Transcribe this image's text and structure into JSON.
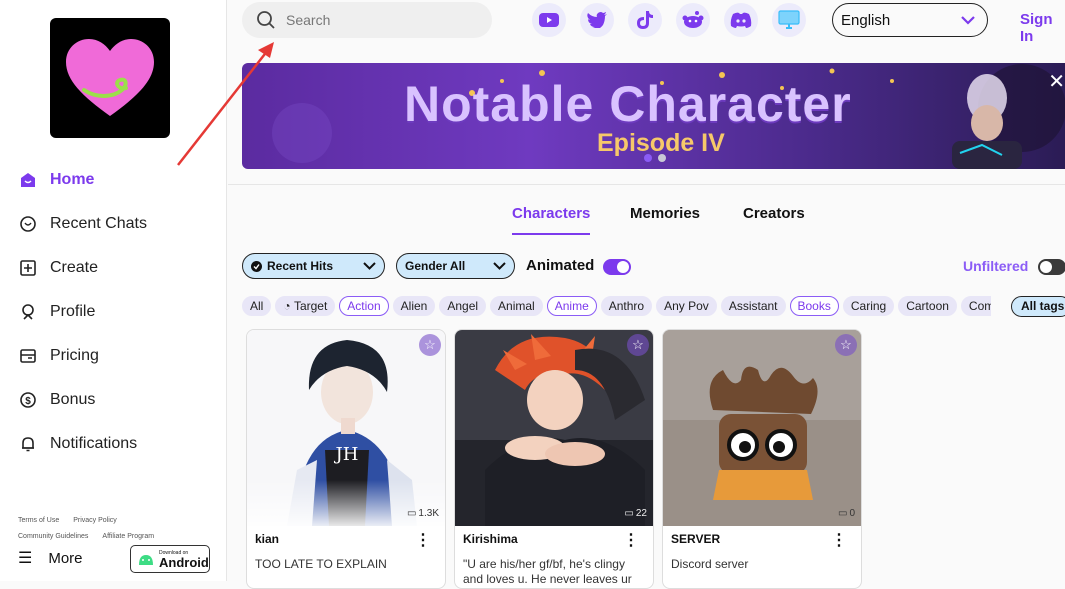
{
  "sidebar": {
    "items": [
      {
        "label": "Home",
        "icon": "home-icon",
        "active": true
      },
      {
        "label": "Recent Chats",
        "icon": "chat-icon"
      },
      {
        "label": "Create",
        "icon": "plus-square-icon"
      },
      {
        "label": "Profile",
        "icon": "profile-icon"
      },
      {
        "label": "Pricing",
        "icon": "card-icon"
      },
      {
        "label": "Bonus",
        "icon": "dollar-icon"
      },
      {
        "label": "Notifications",
        "icon": "bell-icon"
      }
    ],
    "footer_links_row1": [
      "Terms of Use",
      "Privacy Policy"
    ],
    "footer_links_row2": [
      "Community Guidelines",
      "Affiliate Program"
    ],
    "more_label": "More",
    "android_small": "Download on",
    "android_big": "Android"
  },
  "header": {
    "search_placeholder": "Search",
    "socials": [
      "youtube-icon",
      "twitter-icon",
      "tiktok-icon",
      "reddit-icon",
      "discord-icon",
      "desktop-icon"
    ],
    "language": "English",
    "signin_label": "Sign In"
  },
  "banner": {
    "title": "Notable Character",
    "subtitle": "Episode IV",
    "close": "✕"
  },
  "tabs": [
    "Characters",
    "Memories",
    "Creators"
  ],
  "filters": {
    "sort_label": "Recent Hits",
    "gender_label": "Gender All",
    "animated_label": "Animated",
    "unfiltered_label": "Unfiltered",
    "all_tags_label": "All tags"
  },
  "tags": [
    {
      "label": "All",
      "style": "plain"
    },
    {
      "label": "Target",
      "style": "plain"
    },
    {
      "label": "Action",
      "style": "outline"
    },
    {
      "label": "Alien",
      "style": "plain"
    },
    {
      "label": "Angel",
      "style": "plain"
    },
    {
      "label": "Animal",
      "style": "plain"
    },
    {
      "label": "Anime",
      "style": "outline"
    },
    {
      "label": "Anthro",
      "style": "plain"
    },
    {
      "label": "Any Pov",
      "style": "plain"
    },
    {
      "label": "Assistant",
      "style": "plain"
    },
    {
      "label": "Books",
      "style": "outline"
    },
    {
      "label": "Caring",
      "style": "plain"
    },
    {
      "label": "Cartoon",
      "style": "plain"
    },
    {
      "label": "Comed",
      "style": "plain"
    }
  ],
  "cards": [
    {
      "name": "kian",
      "count": "1.3K",
      "desc": "TOO LATE TO EXPLAIN"
    },
    {
      "name": "Kirishima",
      "count": "22",
      "desc": "\"U are his/her gf/bf, he's clingy and loves u. He never leaves ur"
    },
    {
      "name": "SERVER",
      "count": "0",
      "desc": "Discord server"
    }
  ],
  "colors": {
    "accent": "#7c3aed",
    "filter_bg": "#cfe9fb"
  }
}
